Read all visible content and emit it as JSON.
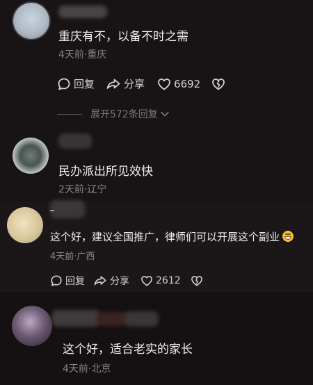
{
  "comments": [
    {
      "text": "重庆有不，以备不时之需",
      "meta": "4天前·重庆",
      "reply_label": "回复",
      "share_label": "分享",
      "like_count": "6692",
      "expand_label": "展开572条回复"
    },
    {
      "text": "民办派出所见效快",
      "meta": "2天前·辽宁"
    },
    {
      "text": "这个好，建议全国推广，律师们可以开展这个副业",
      "meta": "4天前·广西",
      "reply_label": "回复",
      "share_label": "分享",
      "like_count": "2612"
    },
    {
      "text": "这个好，适合老实的家长",
      "meta": "4天前·北京"
    }
  ],
  "icons": {
    "reply": "comment-bubble-icon",
    "share": "share-arrow-icon",
    "like": "heart-icon",
    "dislike": "broken-heart-icon",
    "expand": "chevron-down-icon",
    "emoji": "grinning-face-emoji"
  }
}
